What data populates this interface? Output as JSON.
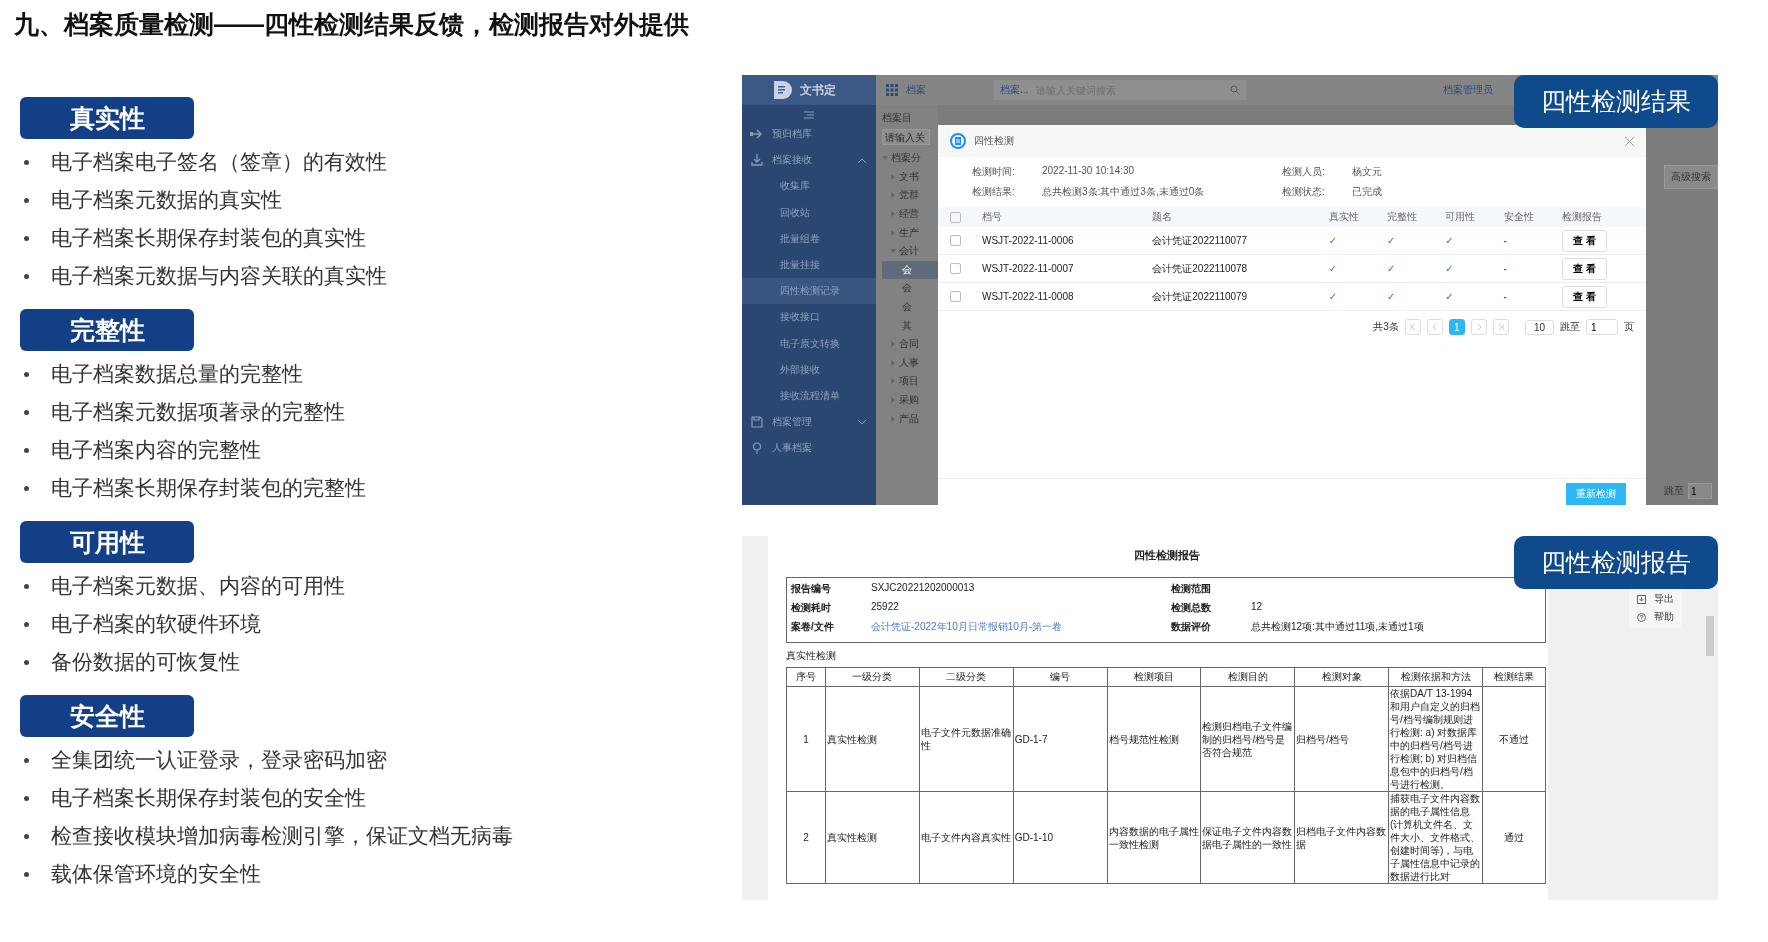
{
  "title": "九、档案质量检测——四性检测结果反馈，检测报告对外提供",
  "sections": [
    {
      "heading": "真实性",
      "items": [
        "电子档案电子签名（签章）的有效性",
        "电子档案元数据的真实性",
        "电子档案长期保存封装包的真实性",
        "电子档案元数据与内容关联的真实性"
      ]
    },
    {
      "heading": "完整性",
      "items": [
        "电子档案数据总量的完整性",
        "电子档案元数据项著录的完整性",
        "电子档案内容的完整性",
        "电子档案长期保存封装包的完整性"
      ]
    },
    {
      "heading": "可用性",
      "items": [
        "电子档案元数据、内容的可用性",
        "电子档案的软硬件环境",
        "备份数据的可恢复性"
      ]
    },
    {
      "heading": "安全性",
      "items": [
        "全集团统一认证登录，登录密码加密",
        "电子档案长期保存封装包的安全性",
        "检查接收模块增加病毒检测引擎，保证文档无病毒",
        "载体保管环境的安全性"
      ]
    }
  ],
  "result_panel": {
    "badge": "四性检测结果",
    "app": {
      "logo": "文书定",
      "module": "档案",
      "search_scope": "档案...",
      "search_placeholder": "请输入关键词搜索",
      "user": "档案管理员",
      "sidebar": [
        {
          "label": "预归档库",
          "kind": "arrow",
          "selected": false
        },
        {
          "label": "档案接收",
          "kind": "download",
          "selected": false,
          "expanded": true,
          "children": [
            {
              "label": "收集库",
              "selected": false
            },
            {
              "label": "回收站",
              "selected": false
            },
            {
              "label": "批量组卷",
              "selected": false
            },
            {
              "label": "批量挂接",
              "selected": false
            },
            {
              "label": "四性检测记录",
              "selected": true
            },
            {
              "label": "接收接口",
              "selected": false
            },
            {
              "label": "电子原文转换",
              "selected": false
            },
            {
              "label": "外部接收",
              "selected": false
            },
            {
              "label": "接收流程清单",
              "selected": false
            }
          ]
        },
        {
          "label": "档案管理",
          "kind": "save",
          "selected": false,
          "expanded": false
        },
        {
          "label": "人事档案",
          "kind": "pin",
          "selected": false
        }
      ],
      "tree_title": "档案目",
      "tree_search_placeholder": "请输入关",
      "tree": [
        {
          "label": "档案分",
          "expanded": true,
          "children": [
            {
              "label": "文书",
              "expanded": false
            },
            {
              "label": "党群",
              "expanded": false
            },
            {
              "label": "经营",
              "expanded": false
            },
            {
              "label": "生产",
              "expanded": false
            },
            {
              "label": "会计",
              "expanded": true,
              "children": [
                {
                  "label": "会",
                  "selected": true
                },
                {
                  "label": "会",
                  "selected": false
                },
                {
                  "label": "会",
                  "selected": false
                },
                {
                  "label": "其",
                  "selected": false
                }
              ]
            },
            {
              "label": "合同",
              "expanded": false
            },
            {
              "label": "人事",
              "expanded": false
            },
            {
              "label": "项目",
              "expanded": false
            },
            {
              "label": "采购",
              "expanded": false
            },
            {
              "label": "产品",
              "expanded": false
            }
          ]
        }
      ],
      "advanced_search": "高级搜索",
      "jump_label": "跳至",
      "jump_value": "1"
    },
    "modal": {
      "title": "四性检测",
      "all_selected": false,
      "fields": [
        {
          "label": "检测时间:",
          "value": "2022-11-30 10:14:30"
        },
        {
          "label": "检测人员:",
          "value": "杨文元"
        },
        {
          "label": "检测结果:",
          "value": "总共检测3条:其中通过3条,未通过0条"
        },
        {
          "label": "检测状态:",
          "value": "已完成"
        }
      ],
      "columns": [
        "档号",
        "题名",
        "真实性",
        "完整性",
        "可用性",
        "安全性",
        "检测报告"
      ],
      "rows": [
        {
          "selected": false,
          "code": "WSJT-2022-11-0006",
          "name": "会计凭证2022110077",
          "checks": [
            "✓",
            "✓",
            "✓",
            "-"
          ],
          "action": "查 看"
        },
        {
          "selected": false,
          "code": "WSJT-2022-11-0007",
          "name": "会计凭证2022110078",
          "checks": [
            "✓",
            "✓",
            "✓",
            "-"
          ],
          "action": "查 看"
        },
        {
          "selected": false,
          "code": "WSJT-2022-11-0008",
          "name": "会计凭证2022110079",
          "checks": [
            "✓",
            "✓",
            "✓",
            "-"
          ],
          "action": "查 看"
        }
      ],
      "total": "共3条",
      "pages": [
        {
          "label": "1",
          "selected": true
        }
      ],
      "page_size": "10",
      "jump_label": "跳至",
      "jump_value": "1",
      "page_unit": "页",
      "recheck": "重新检测"
    }
  },
  "report_panel": {
    "badge": "四性检测报告",
    "title": "四性检测报告",
    "meta": [
      {
        "label": "报告编号",
        "value": "SXJC20221202000013",
        "kind": "text"
      },
      {
        "label": "检测范围",
        "kind": "text"
      },
      {
        "label": "检测耗时",
        "value": "25922",
        "kind": "text"
      },
      {
        "label": "检测总数",
        "value": "12",
        "kind": "text"
      },
      {
        "label": "案卷/文件",
        "value": "会计凭证-2022年10月日常报销10月-第一卷",
        "kind": "link"
      },
      {
        "label": "数据评价",
        "value": "总共检测12项:其中通过11项,未通过1项",
        "kind": "text"
      }
    ],
    "section": "真实性检测",
    "columns": [
      "序号",
      "一级分类",
      "二级分类",
      "编号",
      "检测项目",
      "检测目的",
      "检测对象",
      "检测依据和方法",
      "检测结果"
    ],
    "rows": [
      [
        "1",
        "真实性检测",
        "电子文件元数据准确性",
        "GD-1-7",
        "档号规范性检测",
        "检测归档电子文件编制的归档号/档号是否符合规范",
        "归档号/档号",
        "依据DA/T 13-1994和用户自定义的归档号/档号编制规则进行检测: a) 对数据库中的归档号/档号进行检测; b) 对归档信息包中的归档号/档号进行检测。",
        "不通过"
      ],
      [
        "2",
        "真实性检测",
        "电子文件内容真实性",
        "GD-1-10",
        "内容数据的电子属性一致性检测",
        "保证电子文件内容数据电子属性的一致性",
        "归档电子文件内容数据",
        "捕获电子文件内容数据的电子属性信息(计算机文件名、文件大小、文件格式、创建时间等)，与电子属性信息中记录的数据进行比对",
        "通过"
      ]
    ],
    "tools": [
      {
        "label": "导出",
        "kind": "export"
      },
      {
        "label": "帮助",
        "kind": "help"
      }
    ]
  }
}
